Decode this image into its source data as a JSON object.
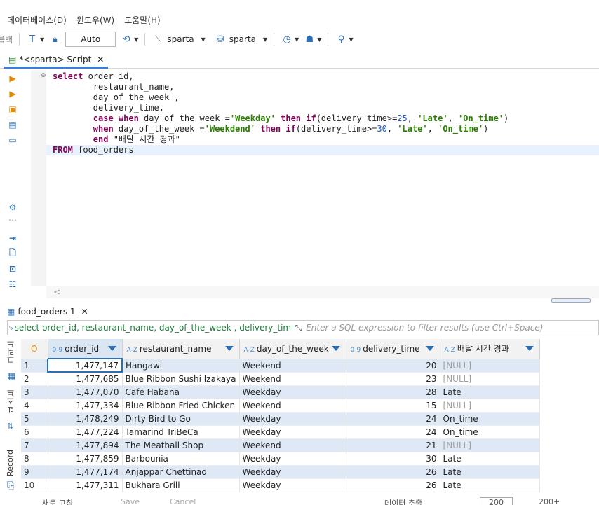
{
  "menu": [
    "데이터베이스(D)",
    "윈도우(W)",
    "도움말(H)"
  ],
  "toolbar": {
    "rollback_label": "롤백",
    "mode_value": "Auto",
    "connection1": "sparta",
    "connection2": "sparta"
  },
  "editor_tab": {
    "label": "*<sparta> Script"
  },
  "code": {
    "l1a": "select",
    "l1b": " order_id,",
    "l2": "        restaurant_name,",
    "l3": "        day_of_the_week ,",
    "l4": "        delivery_time,",
    "l5a": "        case when",
    "l5b": " day_of_the_week =",
    "l5c": "'Weekday'",
    "l5d": " then if",
    "l5e": "(delivery_time>=",
    "l5f": "25",
    "l5g": ", ",
    "l5h": "'Late'",
    "l5i": ", ",
    "l5j": "'On_time'",
    "l5k": ")",
    "l6a": "        when",
    "l6b": " day_of_the_week =",
    "l6c": "'Weekdend'",
    "l6d": " then if",
    "l6e": "(delivery_time>=",
    "l6f": "30",
    "l6g": ", ",
    "l6h": "'Late'",
    "l6i": ", ",
    "l6j": "'On_time'",
    "l6k": ")",
    "l7a": "        end",
    "l7b": " \"배달 시간 경과\"",
    "l8a": "FROM",
    "l8b": " food_orders"
  },
  "scroll_arrow": "<",
  "results": {
    "tab_label": "food_orders 1",
    "filter_query": "select order_id, restaurant_name, day_of_the_week , delivery_time, case",
    "filter_placeholder": "Enter a SQL expression to filter results (use Ctrl+Space)",
    "side_tab_grid": "그리드",
    "side_tab_text": "텍스트",
    "side_tab_record": "Record",
    "columns": [
      {
        "type": "0-9",
        "name": "order_id"
      },
      {
        "type": "A-Z",
        "name": "restaurant_name"
      },
      {
        "type": "A-Z",
        "name": "day_of_the_week"
      },
      {
        "type": "0-9",
        "name": "delivery_time"
      },
      {
        "type": "A-Z",
        "name": "배달 시간 경과"
      }
    ],
    "rows": [
      {
        "n": "1",
        "id": "1,477,147",
        "name": "Hangawi",
        "day": "Weekend",
        "time": "20",
        "res": "[NULL]"
      },
      {
        "n": "2",
        "id": "1,477,685",
        "name": "Blue Ribbon Sushi Izakaya",
        "day": "Weekend",
        "time": "23",
        "res": "[NULL]"
      },
      {
        "n": "3",
        "id": "1,477,070",
        "name": "Cafe Habana",
        "day": "Weekday",
        "time": "28",
        "res": "Late"
      },
      {
        "n": "4",
        "id": "1,477,334",
        "name": "Blue Ribbon Fried Chicken",
        "day": "Weekend",
        "time": "15",
        "res": "[NULL]"
      },
      {
        "n": "5",
        "id": "1,478,249",
        "name": "Dirty Bird to Go",
        "day": "Weekday",
        "time": "24",
        "res": "On_time"
      },
      {
        "n": "6",
        "id": "1,477,224",
        "name": "Tamarind TriBeCa",
        "day": "Weekday",
        "time": "24",
        "res": "On_time"
      },
      {
        "n": "7",
        "id": "1,477,894",
        "name": "The Meatball Shop",
        "day": "Weekend",
        "time": "21",
        "res": "[NULL]"
      },
      {
        "n": "8",
        "id": "1,477,859",
        "name": "Barbounia",
        "day": "Weekday",
        "time": "30",
        "res": "Late"
      },
      {
        "n": "9",
        "id": "1,477,174",
        "name": "Anjappar Chettinad",
        "day": "Weekday",
        "time": "26",
        "res": "Late"
      },
      {
        "n": "10",
        "id": "1,477,311",
        "name": "Bukhara Grill",
        "day": "Weekday",
        "time": "26",
        "res": "Late"
      }
    ]
  },
  "bottom": {
    "refresh": "새로 고침",
    "save": "Save",
    "cancel": "Cancel",
    "export": "데이터 추출",
    "fetch": "200",
    "count": "200+"
  }
}
